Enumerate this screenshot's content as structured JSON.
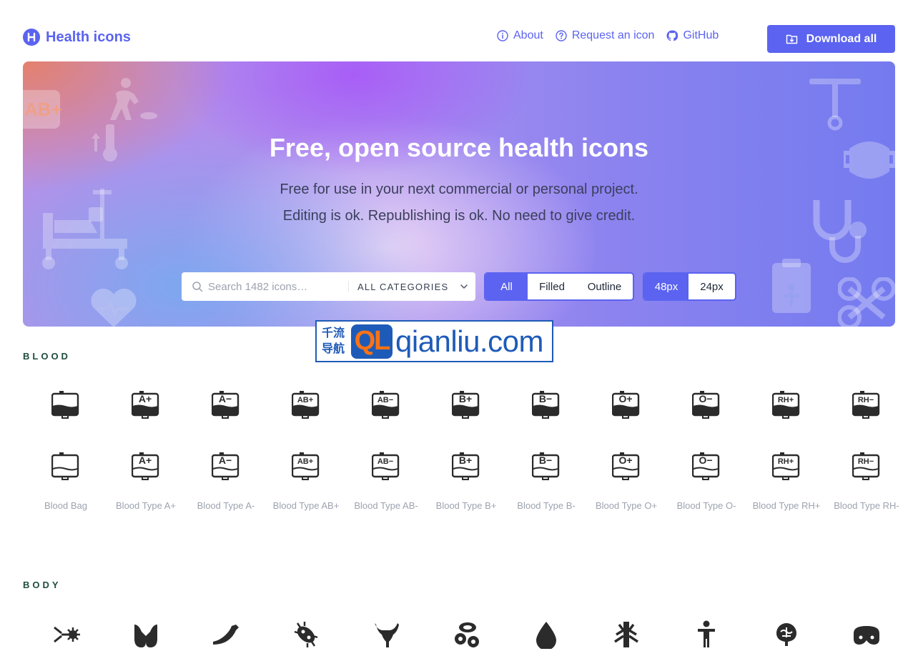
{
  "header": {
    "logo_text": "Health icons",
    "nav": [
      {
        "label": "About",
        "icon": "info-icon"
      },
      {
        "label": "Request an icon",
        "icon": "question-icon"
      },
      {
        "label": "GitHub",
        "icon": "github-icon"
      }
    ],
    "download_label": "Download all"
  },
  "hero": {
    "title": "Free, open source health icons",
    "line1": "Free for use in your next commercial or personal project.",
    "line2": "Editing is ok. Republishing is ok. No need to give credit.",
    "search_placeholder": "Search 1482 icons…",
    "category_label": "ALL CATEGORIES",
    "style_options": [
      "All",
      "Filled",
      "Outline"
    ],
    "style_selected": "All",
    "size_options": [
      "48px",
      "24px"
    ],
    "size_selected": "48px"
  },
  "watermark": {
    "cn_top": "千流",
    "cn_bottom": "导航",
    "badge": "QL",
    "site": "qianliu.com"
  },
  "sections": [
    {
      "title": "BLOOD",
      "icons": [
        {
          "name": "Blood Bag",
          "mark": ""
        },
        {
          "name": "Blood Type A+",
          "mark": "A+"
        },
        {
          "name": "Blood Type A-",
          "mark": "A−"
        },
        {
          "name": "Blood Type AB+",
          "mark": "AB+"
        },
        {
          "name": "Blood Type AB-",
          "mark": "AB−"
        },
        {
          "name": "Blood Type B+",
          "mark": "B+"
        },
        {
          "name": "Blood Type B-",
          "mark": "B−"
        },
        {
          "name": "Blood Type O+",
          "mark": "O+"
        },
        {
          "name": "Blood Type O-",
          "mark": "O−"
        },
        {
          "name": "Blood Type RH+",
          "mark": "RH+"
        },
        {
          "name": "Blood Type RH-",
          "mark": "RH−"
        }
      ]
    },
    {
      "title": "BODY",
      "icons": [
        "antibody-icon",
        "thyroid-icon",
        "arm-icon",
        "bacteria-icon",
        "uterus-icon",
        "blood-cells-icon",
        "blood-drop-icon",
        "lungs-icon",
        "body-icon",
        "brain-icon",
        "breasts-icon"
      ]
    }
  ],
  "colors": {
    "brand": "#5b63f0",
    "icon": "#2b2b2b",
    "label": "#9ca3af",
    "section_title": "#1f4d3d"
  }
}
